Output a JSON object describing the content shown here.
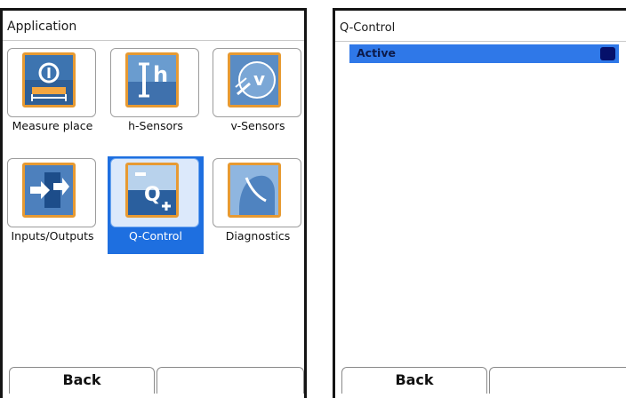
{
  "left_panel": {
    "title": "Application",
    "tiles": [
      {
        "label": "Measure place",
        "icon": "measure-place-icon"
      },
      {
        "label": "h-Sensors",
        "icon": "h-sensor-icon"
      },
      {
        "label": "v-Sensors",
        "icon": "v-sensor-icon"
      },
      {
        "label": "Inputs/Outputs",
        "icon": "inputs-outputs-icon"
      },
      {
        "label": "Q-Control",
        "icon": "q-control-icon",
        "selected": true
      },
      {
        "label": "Diagnostics",
        "icon": "diagnostics-icon"
      }
    ],
    "softkeys": {
      "back": "Back",
      "right": ""
    }
  },
  "right_panel": {
    "title": "Q-Control",
    "items": [
      {
        "label": "Active",
        "checked": true
      }
    ],
    "softkeys": {
      "back": "Back",
      "right": ""
    }
  },
  "colors": {
    "selection": "#1e6fe0",
    "list_highlight": "#2f78e8",
    "icon_border": "#e79a32",
    "checkbox_fill": "#05106a"
  }
}
